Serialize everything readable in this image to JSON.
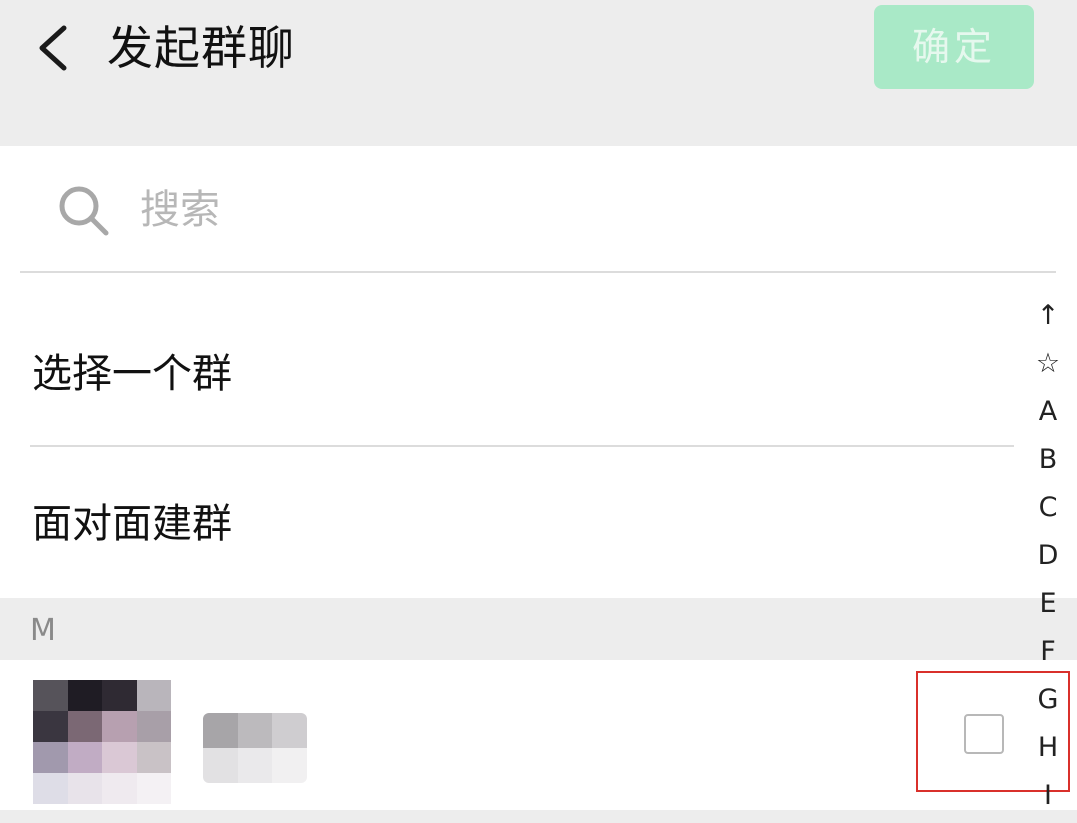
{
  "header": {
    "title": "发起群聊",
    "confirm_label": "确定"
  },
  "search": {
    "placeholder": "搜索",
    "value": ""
  },
  "menu": [
    {
      "label": "选择一个群"
    },
    {
      "label": "面对面建群"
    }
  ],
  "section": {
    "letter": "M"
  },
  "contact": {
    "checked": false
  },
  "index": [
    "↑",
    "☆",
    "A",
    "B",
    "C",
    "D",
    "E",
    "F",
    "G",
    "H",
    "I"
  ],
  "colors": {
    "accent_disabled": "#a9e9c7",
    "highlight_border": "#d9302b",
    "background": "#ededed"
  },
  "icons": {
    "back": "chevron-left-icon",
    "search": "search-icon"
  }
}
